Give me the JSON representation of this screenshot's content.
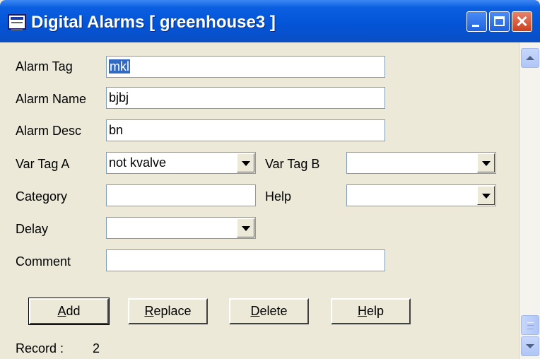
{
  "window": {
    "title": "Digital Alarms [ greenhouse3 ]",
    "icon": "form-window-icon",
    "controls": {
      "minimize": "minimize-icon",
      "maximize": "maximize-icon",
      "close": "close-icon",
      "close_glyph": "✕"
    }
  },
  "form": {
    "alarm_tag": {
      "label": "Alarm Tag",
      "value": "mkl"
    },
    "alarm_name": {
      "label": "Alarm Name",
      "value": "bjbj"
    },
    "alarm_desc": {
      "label": "Alarm Desc",
      "value": "bn"
    },
    "var_tag_a": {
      "label": "Var Tag A",
      "value": "not kvalve"
    },
    "var_tag_b": {
      "label": "Var Tag B",
      "value": ""
    },
    "category": {
      "label": "Category",
      "value": ""
    },
    "help": {
      "label": "Help",
      "value": ""
    },
    "delay": {
      "label": "Delay",
      "value": ""
    },
    "comment": {
      "label": "Comment",
      "value": ""
    }
  },
  "buttons": {
    "add": {
      "mnemonic": "A",
      "rest": "dd"
    },
    "replace": {
      "mnemonic": "R",
      "rest": "eplace"
    },
    "delete": {
      "mnemonic": "D",
      "rest": "elete"
    },
    "help": {
      "mnemonic": "H",
      "rest": "elp"
    }
  },
  "status": {
    "record_label": "Record :",
    "record_value": "2"
  },
  "colors": {
    "titlebar": "#0453d6",
    "dialog_bg": "#ece9d8",
    "selection": "#316ac5",
    "close_button": "#c9401f"
  }
}
